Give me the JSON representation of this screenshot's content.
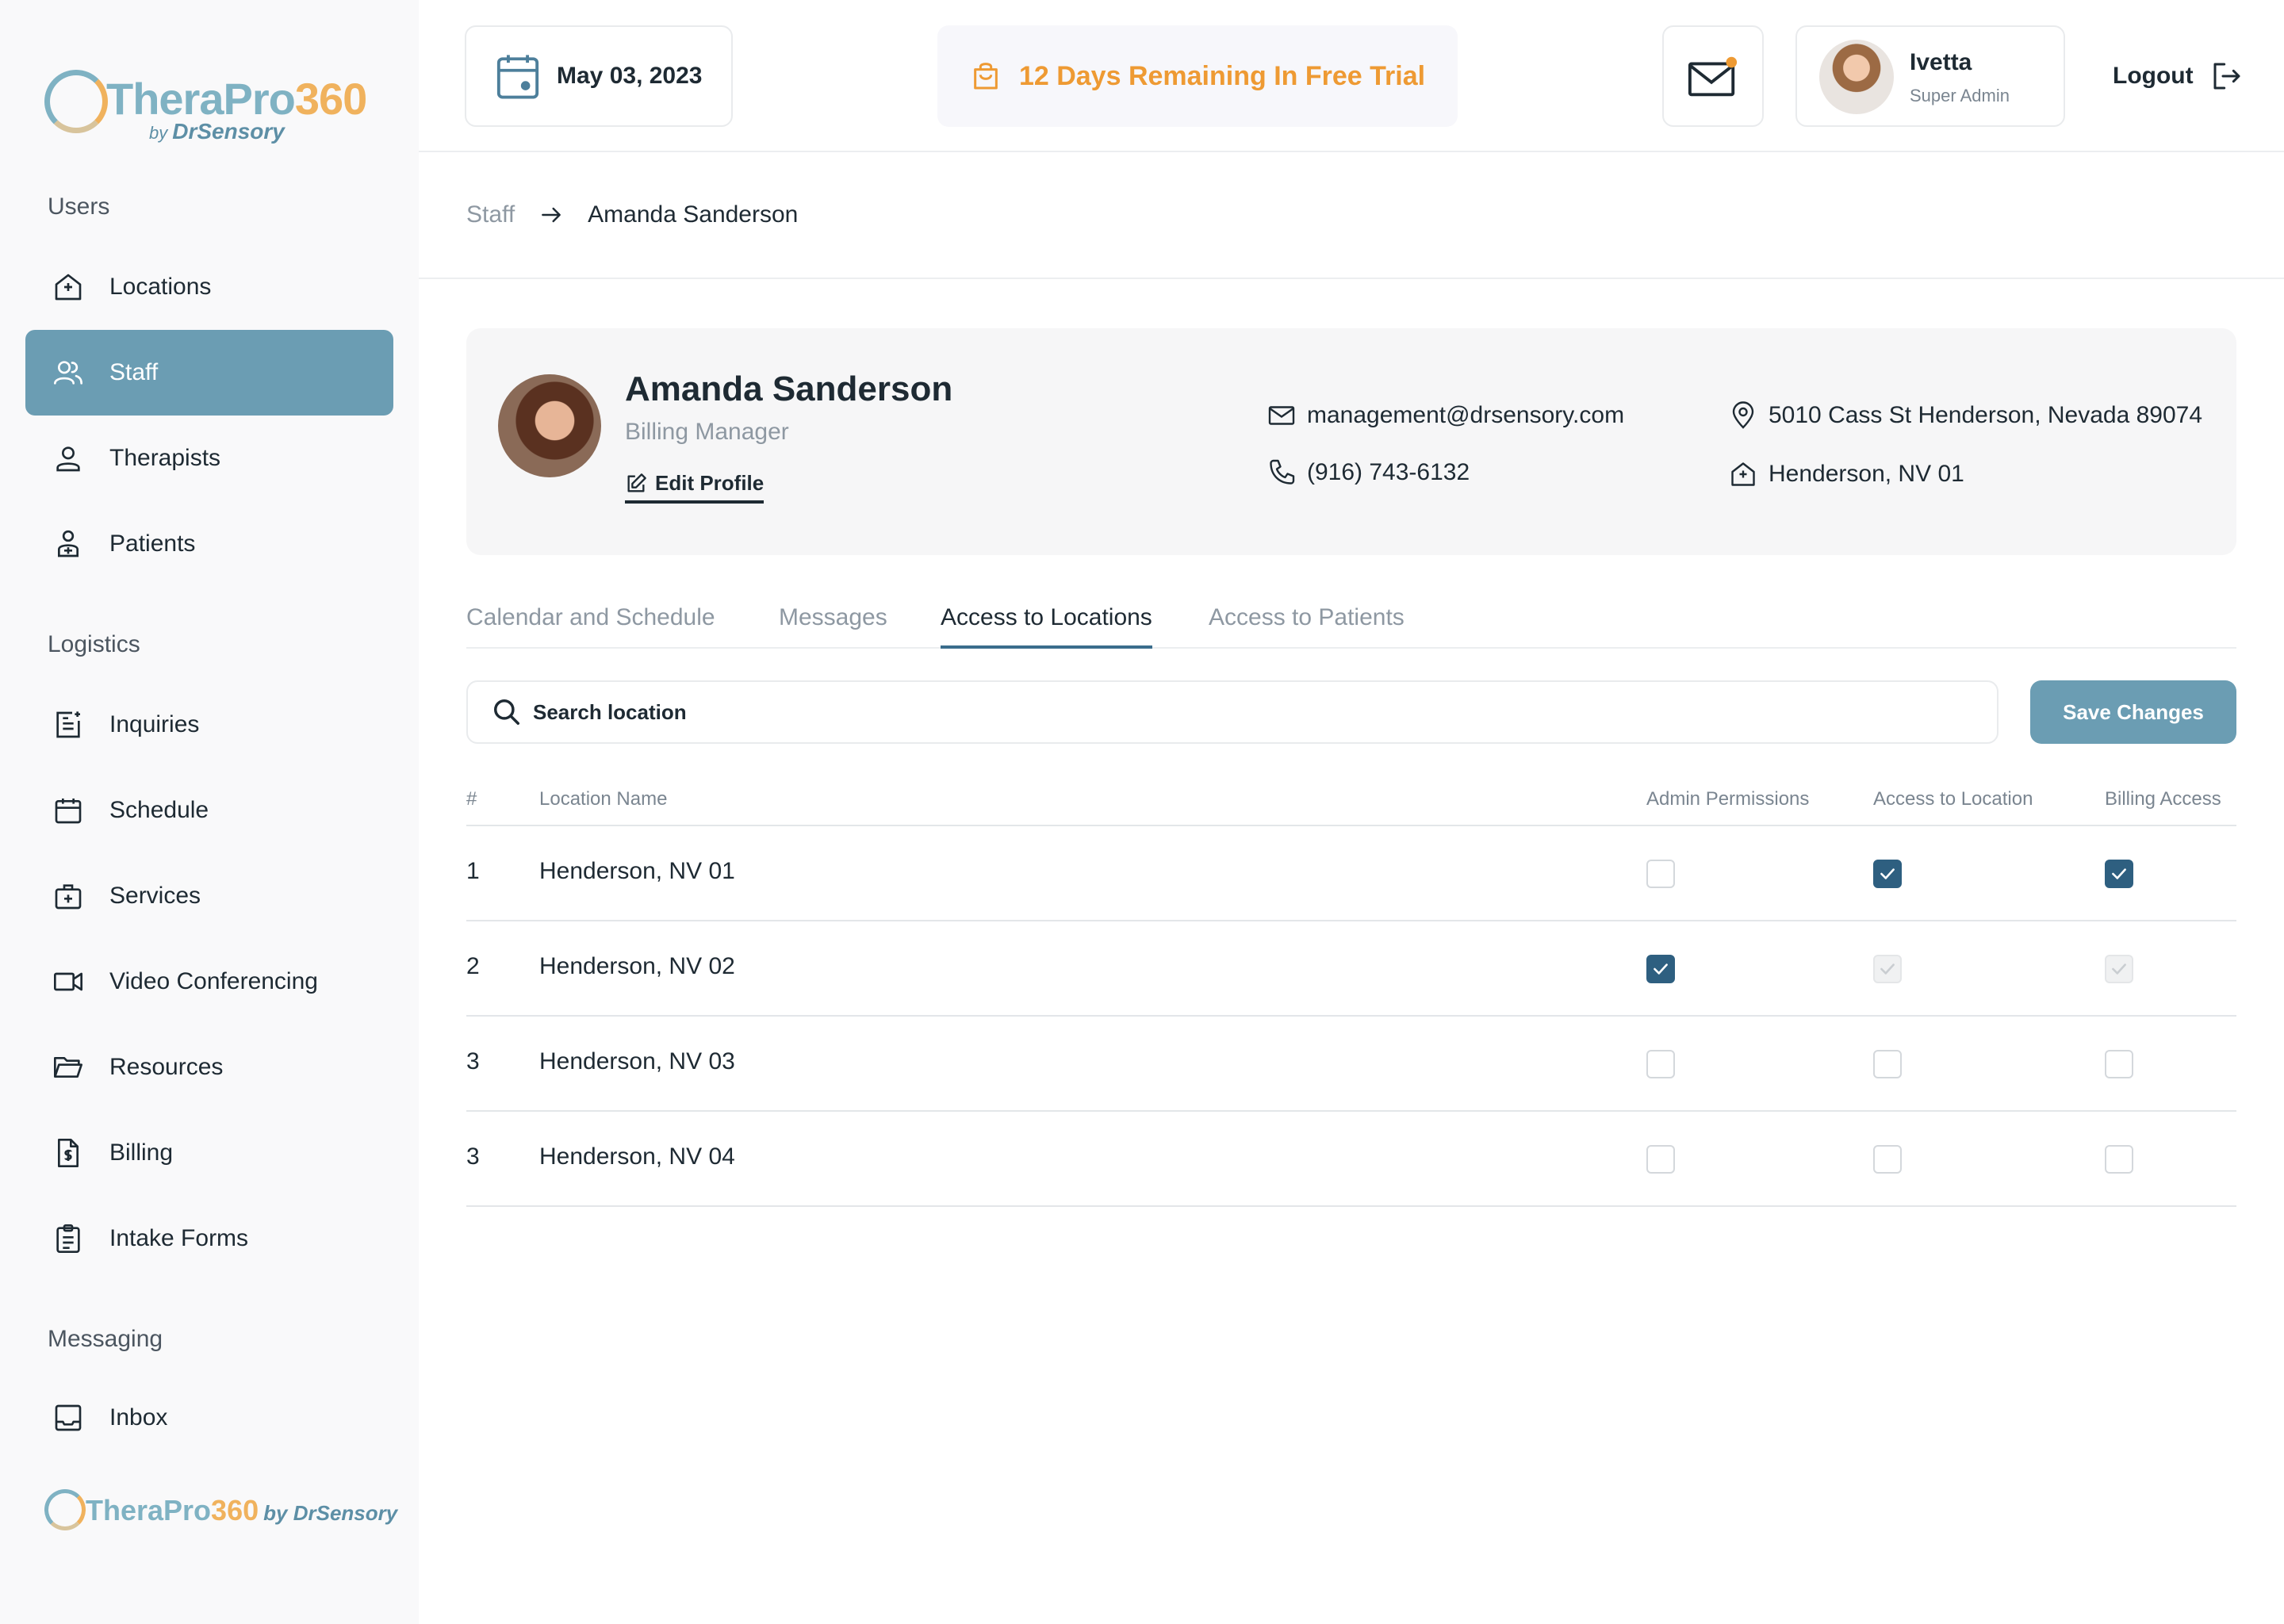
{
  "brand": {
    "name_part1": "TheraPro",
    "name_part2": "360",
    "by_prefix": "by",
    "by_name": "DrSensory"
  },
  "sidebar": {
    "sections": [
      {
        "title": "Users",
        "items": [
          {
            "label": "Locations",
            "icon": "location-home-icon"
          },
          {
            "label": "Staff",
            "icon": "users-icon",
            "active": true
          },
          {
            "label": "Therapists",
            "icon": "user-icon"
          },
          {
            "label": "Patients",
            "icon": "patient-icon"
          }
        ]
      },
      {
        "title": "Logistics",
        "items": [
          {
            "label": "Inquiries",
            "icon": "inquiries-icon"
          },
          {
            "label": "Schedule",
            "icon": "calendar-icon"
          },
          {
            "label": "Services",
            "icon": "services-icon"
          },
          {
            "label": "Video Conferencing",
            "icon": "video-icon"
          },
          {
            "label": "Resources",
            "icon": "folder-icon"
          },
          {
            "label": "Billing",
            "icon": "billing-icon"
          },
          {
            "label": "Intake Forms",
            "icon": "clipboard-icon"
          }
        ]
      },
      {
        "title": "Messaging",
        "items": [
          {
            "label": "Inbox",
            "icon": "inbox-icon"
          }
        ]
      }
    ]
  },
  "header": {
    "date": "May 03, 2023",
    "trial": "12 Days Remaining In Free Trial",
    "user_name": "Ivetta",
    "user_role": "Super Admin",
    "logout": "Logout"
  },
  "breadcrumb": {
    "parent": "Staff",
    "current": "Amanda Sanderson"
  },
  "profile": {
    "name": "Amanda Sanderson",
    "role": "Billing Manager",
    "edit": "Edit Profile",
    "email": "management@drsensory.com",
    "phone": "(916) 743-6132",
    "address": "5010 Cass St Henderson, Nevada 89074",
    "location": "Henderson, NV 01"
  },
  "tabs": [
    "Calendar and Schedule",
    "Messages",
    "Access to Locations",
    "Access to Patients"
  ],
  "active_tab": 2,
  "search": {
    "placeholder": "Search location"
  },
  "save_label": "Save Changes",
  "table": {
    "headers": [
      "#",
      "Location Name",
      "Admin Permissions",
      "Access to Location",
      "Billing Access"
    ],
    "rows": [
      {
        "num": "1",
        "name": "Henderson, NV 01",
        "admin": "unchecked",
        "access": "checked",
        "billing": "checked"
      },
      {
        "num": "2",
        "name": "Henderson, NV 02",
        "admin": "checked",
        "access": "disabled-checked",
        "billing": "disabled-checked"
      },
      {
        "num": "3",
        "name": "Henderson, NV 03",
        "admin": "unchecked",
        "access": "unchecked",
        "billing": "unchecked"
      },
      {
        "num": "3",
        "name": "Henderson, NV 04",
        "admin": "unchecked",
        "access": "unchecked",
        "billing": "unchecked"
      }
    ]
  },
  "colors": {
    "accent": "#6b9db3",
    "checkbox": "#2e5f80",
    "trial": "#ee9a33"
  }
}
